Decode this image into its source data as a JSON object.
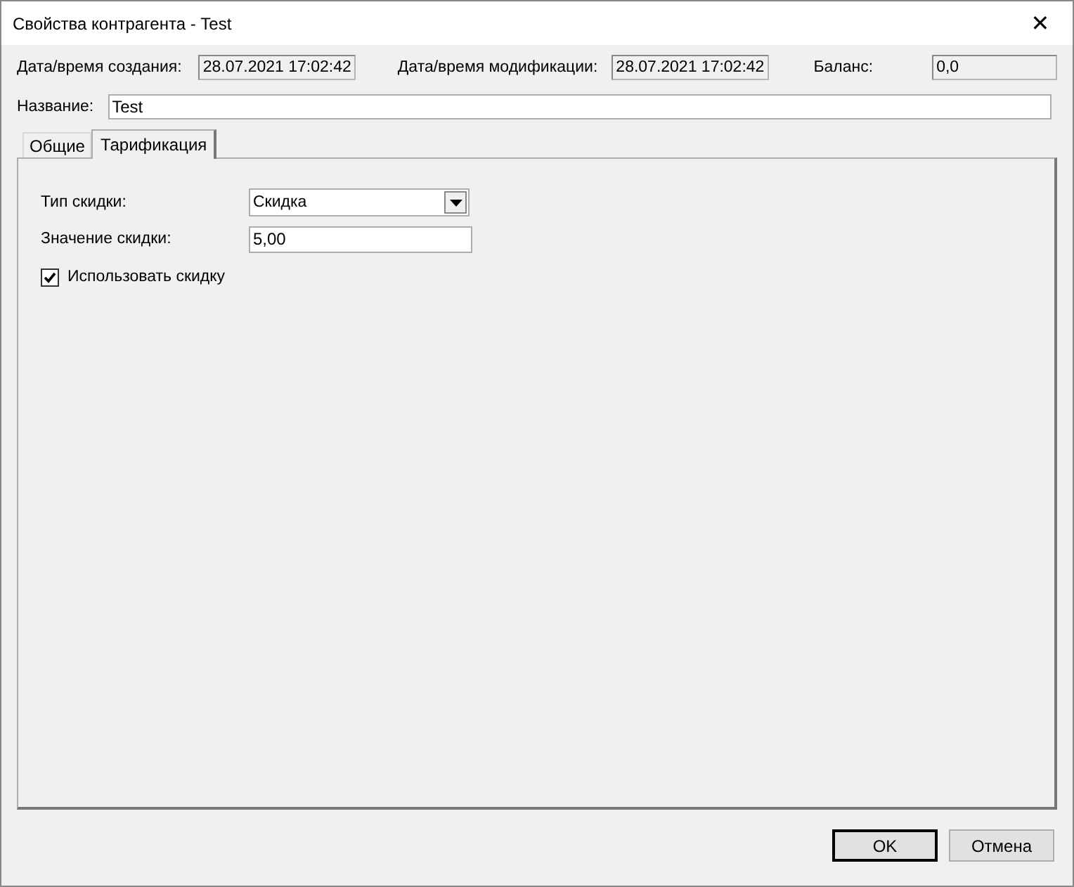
{
  "window": {
    "title": "Свойства контрагента - Test",
    "close": "✕"
  },
  "header": [
    {
      "label": "Дата/время создания:",
      "value": "28.07.2021 17:02:42"
    },
    {
      "label": "Дата/время модификации:",
      "value": "28.07.2021 17:02:42"
    },
    {
      "label": "Баланс:",
      "value": "0,0"
    }
  ],
  "name": {
    "label": "Название:",
    "value": "Test"
  },
  "tabs": [
    {
      "label": "Общие",
      "selected": false
    },
    {
      "label": "Тарификация",
      "selected": true
    }
  ],
  "fields": [
    {
      "kind": "dropdown",
      "label": "Тип скидки:",
      "value": "Скидка"
    },
    {
      "kind": "text",
      "label": "Значение скидки:",
      "value": "5,00"
    },
    {
      "kind": "checkbox",
      "label": "Использовать скидку",
      "checked": true
    }
  ],
  "buttons": [
    {
      "label": "OK",
      "default": true
    },
    {
      "label": "Отмена",
      "default": false
    }
  ]
}
